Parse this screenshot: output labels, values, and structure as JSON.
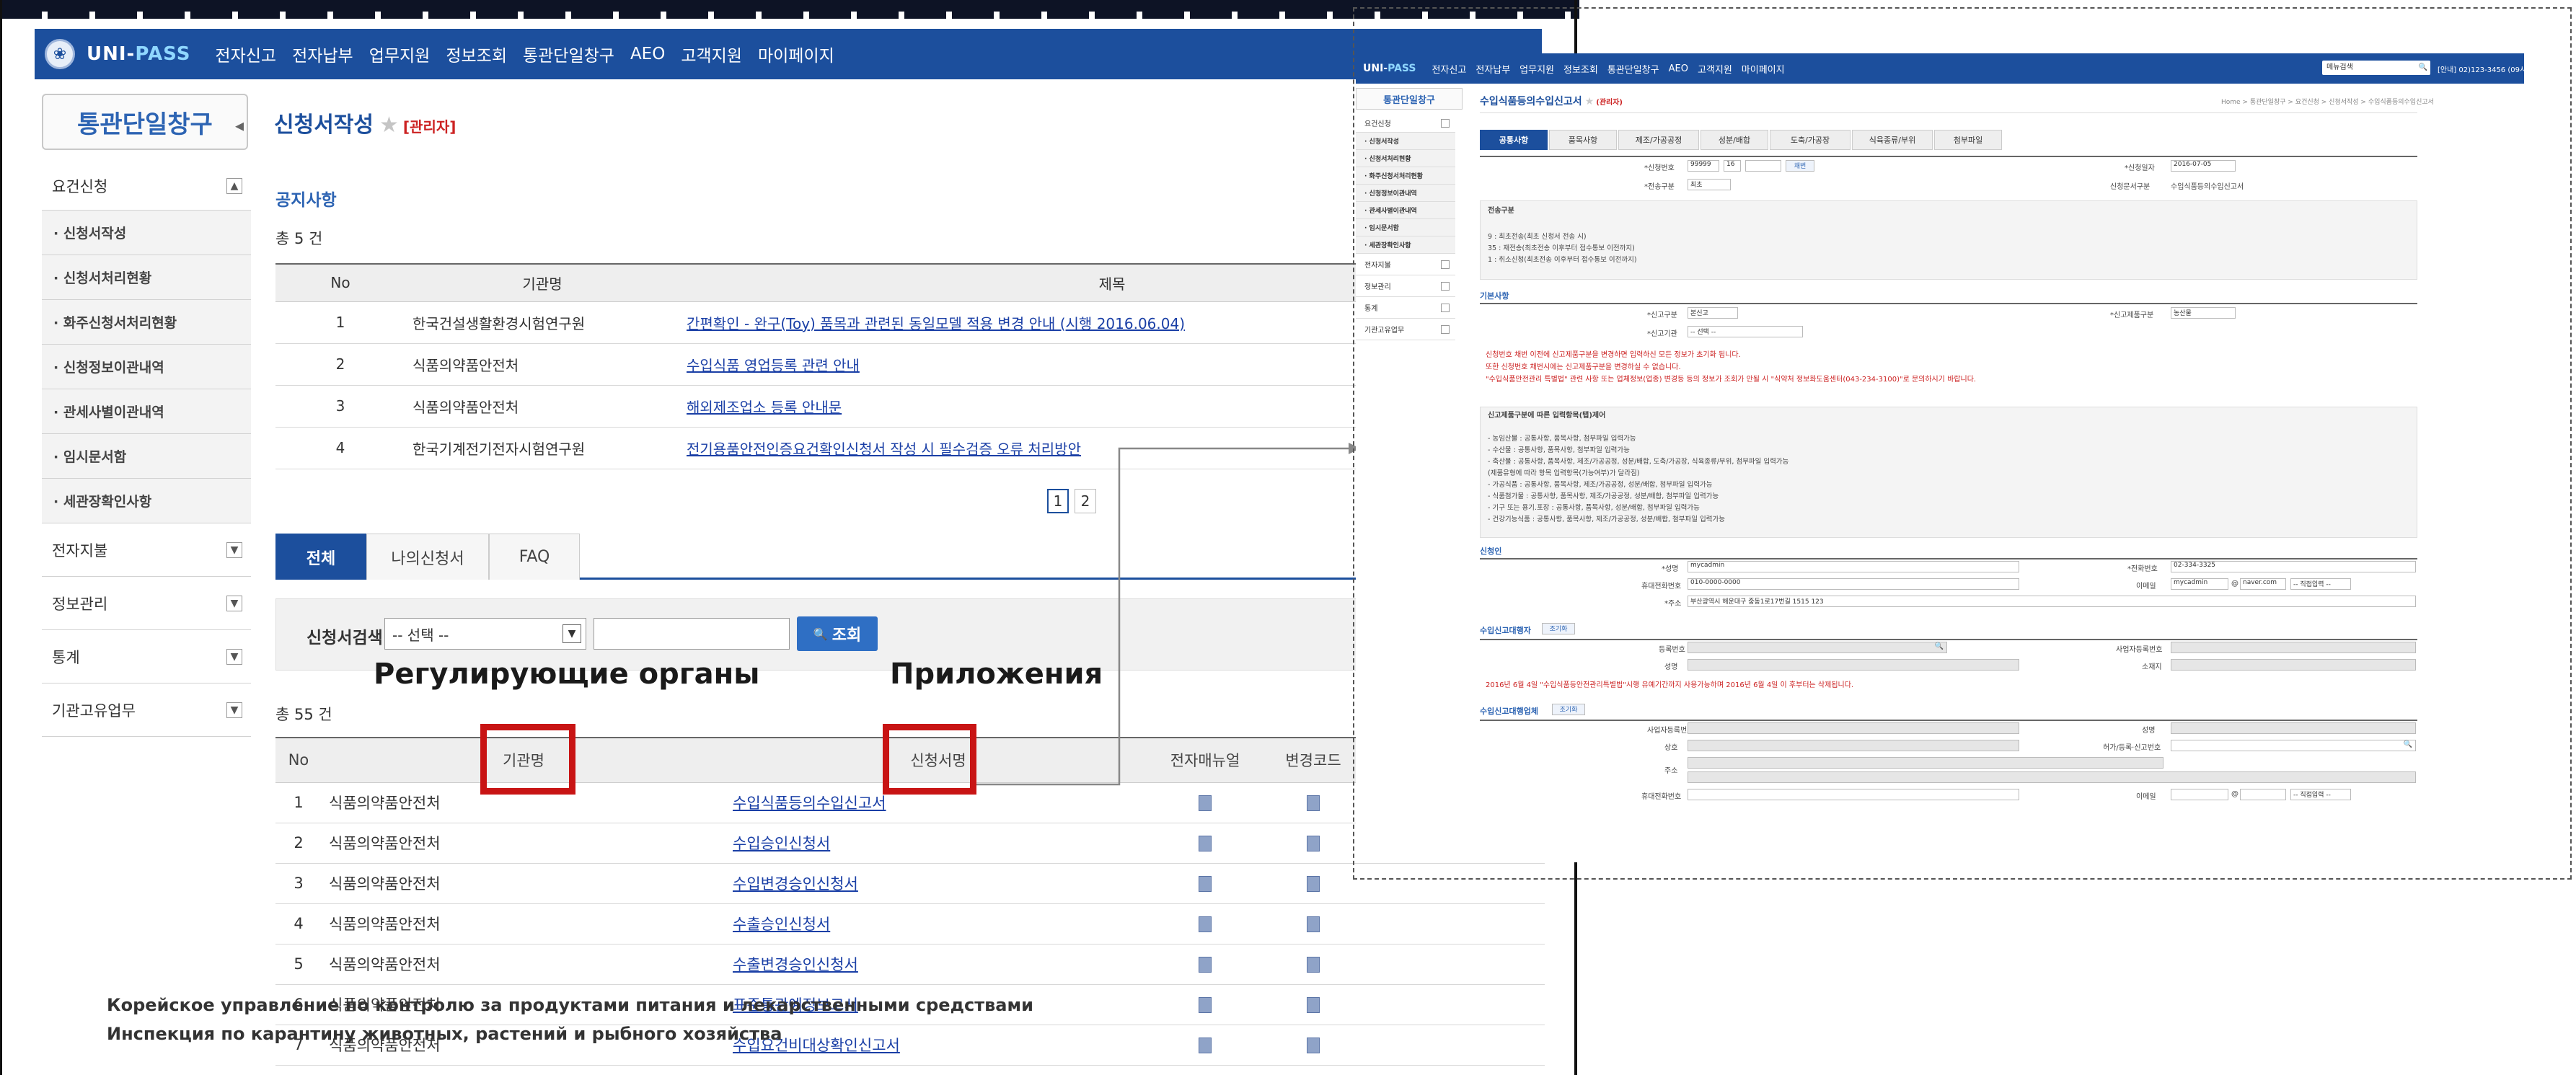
{
  "left_screen": {
    "logo": {
      "brand_a": "UNI-",
      "brand_b": "PASS"
    },
    "menu": [
      "전자신고",
      "전자납부",
      "업무지원",
      "정보조회",
      "통관단일창구",
      "AEO",
      "고객지원",
      "마이페이지"
    ],
    "sidebar_title": "통관단일창구",
    "sidebar_items": [
      {
        "label": "요건신청",
        "type": "group",
        "btn": "▲"
      },
      {
        "label": "· 신청서작성",
        "type": "sub"
      },
      {
        "label": "· 신청서처리현황",
        "type": "sub"
      },
      {
        "label": "· 화주신청서처리현황",
        "type": "sub"
      },
      {
        "label": "· 신청정보이관내역",
        "type": "sub"
      },
      {
        "label": "· 관세사별이관내역",
        "type": "sub"
      },
      {
        "label": "· 임시문서함",
        "type": "sub"
      },
      {
        "label": "· 세관장확인사항",
        "type": "sub"
      },
      {
        "label": "전자지불",
        "type": "group",
        "btn": "▼"
      },
      {
        "label": "정보관리",
        "type": "group",
        "btn": "▼"
      },
      {
        "label": "통계",
        "type": "group",
        "btn": "▼"
      },
      {
        "label": "기관고유업무",
        "type": "group",
        "btn": "▼"
      }
    ],
    "page_title": "신청서작성",
    "admin_tag": "[관리자]",
    "notice": {
      "title": "공지사항",
      "count": "총 5 건",
      "headers": [
        "No",
        "기관명",
        "제목"
      ],
      "rows": [
        {
          "no": "1",
          "org": "한국건설생활환경시험연구원",
          "title": "간편확인 - 완구(Toy) 품목과 관련된 동일모델 적용 변경 안내 (시행 2016.06.04)"
        },
        {
          "no": "2",
          "org": "식품의약품안전처",
          "title": "수입식품 영업등록 관련 안내"
        },
        {
          "no": "3",
          "org": "식품의약품안전처",
          "title": "해외제조업소 등록 안내문"
        },
        {
          "no": "4",
          "org": "한국기계전기전자시험연구원",
          "title": "전기용품안전인증요건확인신청서 작성 시 필수검증 오류 처리방안"
        }
      ],
      "pages": [
        "1",
        "2"
      ]
    },
    "tabs": [
      "전체",
      "나의신청서",
      "FAQ"
    ],
    "search": {
      "label": "신청서검색",
      "select": "-- 선택 --",
      "select_arrow": "▼",
      "button": "조회",
      "button_icon": "🔍"
    },
    "list": {
      "count": "총 55 건",
      "headers": [
        "No",
        "기관명",
        "신청서명",
        "전자매뉴얼",
        "변경코드"
      ],
      "rows": [
        {
          "no": "1",
          "org": "식품의약품안전처",
          "form": "수입식품등의수입신고서"
        },
        {
          "no": "2",
          "org": "식품의약품안전처",
          "form": "수입승인신청서"
        },
        {
          "no": "3",
          "org": "식품의약품안전처",
          "form": "수입변경승인신청서"
        },
        {
          "no": "4",
          "org": "식품의약품안전처",
          "form": "수출승인신청서"
        },
        {
          "no": "5",
          "org": "식품의약품안전처",
          "form": "수출변경승인신청서"
        },
        {
          "no": "6",
          "org": "식품의약품안전처",
          "form": "표준통관예정보고서"
        },
        {
          "no": "7",
          "org": "식품의약품안전처",
          "form": "수입요건비대상확인신고서"
        }
      ]
    }
  },
  "annotations": {
    "label_regulators": "Регулирующие органы",
    "label_applications": "Приложения",
    "footnote_1": "Корейское управление по контролю за продуктами питания и лекарственными средствами",
    "footnote_2": "Инспекция по карантину животных, растений и рыбного хозяйства"
  },
  "right_screen": {
    "logo": {
      "brand_a": "UNI-",
      "brand_b": "PASS"
    },
    "menu": [
      "전자신고",
      "전자납부",
      "업무지원",
      "정보조회",
      "통관단일창구",
      "AEO",
      "고객지원",
      "마이페이지"
    ],
    "top_right": {
      "search": "메뉴검색",
      "info": "[안내] 02)123-3456 (09시~18시)"
    },
    "sidebar_title": "통관단일창구",
    "sidebar_items": [
      {
        "label": "요건신청",
        "type": "group"
      },
      {
        "label": "· 신청서작성",
        "type": "sub"
      },
      {
        "label": "· 신청서처리현황",
        "type": "sub"
      },
      {
        "label": "· 화주신청서처리현황",
        "type": "sub"
      },
      {
        "label": "· 신청정보이관내역",
        "type": "sub"
      },
      {
        "label": "· 관세사별이관내역",
        "type": "sub"
      },
      {
        "label": "· 임시문서함",
        "type": "sub"
      },
      {
        "label": "· 세관장확인사항",
        "type": "sub"
      },
      {
        "label": "전자지불",
        "type": "group"
      },
      {
        "label": "정보관리",
        "type": "group"
      },
      {
        "label": "통계",
        "type": "group"
      },
      {
        "label": "기관고유업무",
        "type": "group"
      }
    ],
    "page_title": "수입식품등의수입신고서",
    "admin_tag": "(관리자)",
    "breadcrumb": "Home > 통관단일창구 > 요건신청 > 신청서작성 > 수입식품등의수입신고서",
    "steps": [
      "공통사항",
      "품목사항",
      "제조/가공공정",
      "성분/배합",
      "도축/가공장",
      "식육종류/부위",
      "첨부파일"
    ],
    "basic": {
      "app_no_label": "*신청번호",
      "app_no_a": "99999",
      "app_no_b": "16",
      "app_no_btn": "채번",
      "app_date_label": "*신청일자",
      "app_date": "2016-07-05",
      "send_type_label": "*전송구분",
      "send_type": "최초",
      "doc_type_label": "신청문서구분",
      "doc_type": "수입식품등의수입신고서"
    },
    "send_section": {
      "title": "전송구분",
      "lines": [
        "9 : 최초전송(최초 신청서 전송 시)",
        "35 : 재전송(최초전송 이후부터 접수통보 이전까지)",
        "1 : 취소신청(최초전송 이후부터 접수통보 이전까지)"
      ]
    },
    "basic_section": {
      "title": "기본사항",
      "report_type_label": "*신고구분",
      "report_type": "본신고",
      "product_type_label": "*신고제품구분",
      "product_type": "농산물",
      "agency_label": "*신고기관",
      "agency": "-- 선택 --",
      "notes": [
        "신청번호 채번 이전에 신고제품구분을 변경하면 입력하신 모든 정보가 초기화 됩니다.",
        "또한 신청번호 채번시에는 신고제품구분을 변경하실 수 없습니다.",
        "\"수입식품안전관리 특별법\" 관련 사항 또는 업체정보(업종) 변경등 등의 정보가 조회가 안될 시 \"식약처 정보화도움센터(043-234-3100)\"로 문의하시기 바랍니다."
      ]
    },
    "input_section": {
      "title": "신고제품구분에 따른 입력항목(탭)제어",
      "lines": [
        "- 농임산물 : 공통사항, 품목사항, 첨부파일 입력가능",
        "- 수산물 : 공통사항, 품목사항, 첨부파일 입력가능",
        "- 축산물 : 공통사항, 품목사항, 제조/가공공정, 성분/배합, 도축/가공장, 식육종류/부위, 첨부파일 입력가능",
        "            (제품유형에 따라 항목 입력항목(가능여부)가 달라짐)",
        "- 가공식품 : 공통사항, 품목사항, 제조/가공공정, 성분/배합, 첨부파일 입력가능",
        "- 식품첨가물 : 공통사항, 품목사항, 제조/가공공정, 성분/배합, 첨부파일 입력가능",
        "- 기구 또는 용기.포장 : 공통사항, 품목사항, 성분/배합, 첨부파일 입력가능",
        "- 건강기능식품 : 공통사항, 품목사항, 제조/가공공정, 성분/배합, 첨부파일 입력가능"
      ]
    },
    "applicant": {
      "title": "신청인",
      "name_label": "*성명",
      "name": "mycadmin",
      "phone_label": "*전화번호",
      "phone": "02-334-3325",
      "mobile_label": "휴대전화번호",
      "mobile": "010-0000-0000",
      "email_label": "이메일",
      "email_a": "mycadmin",
      "email_at": "@",
      "email_b": "naver.com",
      "email_sel": "-- 직접입력 --",
      "addr_label": "*주소",
      "addr": "부산광역시 해운대구 중동1로17번길 1515 123"
    },
    "agent": {
      "title": "수입신고대행자",
      "btn": "조기화",
      "reg_label": "등록번호",
      "biz_label": "사업자등록번호",
      "name_label": "성명",
      "loc_label": "소재지",
      "notice": "2016년 6월 4일 \"수입식품등안전관리특별법\"시행 유예기간까지 사용가능하며 2016년 6월 4일 이 후부터는 삭제됩니다."
    },
    "company": {
      "title": "수입신고대행업체",
      "btn": "조기화",
      "biz_label": "사업자등록번호",
      "name_label": "성명",
      "trade_label": "상호",
      "permit_label": "허가/등록·신고번호",
      "addr_label": "주소",
      "mobile_label": "휴대전화번호",
      "email_label": "이메일",
      "email_at": "@",
      "email_sel": "-- 직접입력 --"
    }
  },
  "colors": {
    "nav": "#1c4f9d",
    "accent_red": "#c81414",
    "link": "#1a3fa6"
  }
}
